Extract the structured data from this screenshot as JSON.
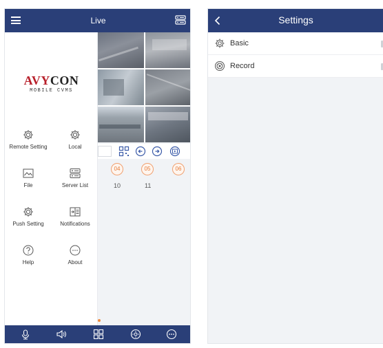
{
  "left_screen": {
    "topbar": {
      "title": "Live"
    },
    "logo": {
      "brand_prefix": "AVY",
      "brand_suffix": "CON",
      "brand_mark": "AVYCON",
      "subtitle": "MOBILE CVMS"
    },
    "menu": [
      {
        "label": "Remote Setting",
        "icon": "gear-icon"
      },
      {
        "label": "Local",
        "icon": "gear-icon"
      },
      {
        "label": "File",
        "icon": "image-file-icon"
      },
      {
        "label": "Server List",
        "icon": "server-list-icon"
      },
      {
        "label": "Push Setting",
        "icon": "gear-icon"
      },
      {
        "label": "Notifications",
        "icon": "notifications-icon"
      },
      {
        "label": "Help",
        "icon": "help-icon"
      },
      {
        "label": "About",
        "icon": "about-icon"
      }
    ],
    "channels": [
      "04",
      "05",
      "06"
    ],
    "channel_numbers": [
      "10",
      "11"
    ],
    "bottom_bar": [
      "microphone-icon",
      "speaker-icon",
      "grid-layout-icon",
      "ptz-icon",
      "more-icon"
    ]
  },
  "right_screen": {
    "topbar": {
      "title": "Settings"
    },
    "items": [
      {
        "label": "Basic",
        "icon": "gear-icon"
      },
      {
        "label": "Record",
        "icon": "record-icon"
      }
    ]
  },
  "colors": {
    "header": "#2a3f78",
    "accent_orange": "#e57a38",
    "brand_red": "#b8202b"
  }
}
